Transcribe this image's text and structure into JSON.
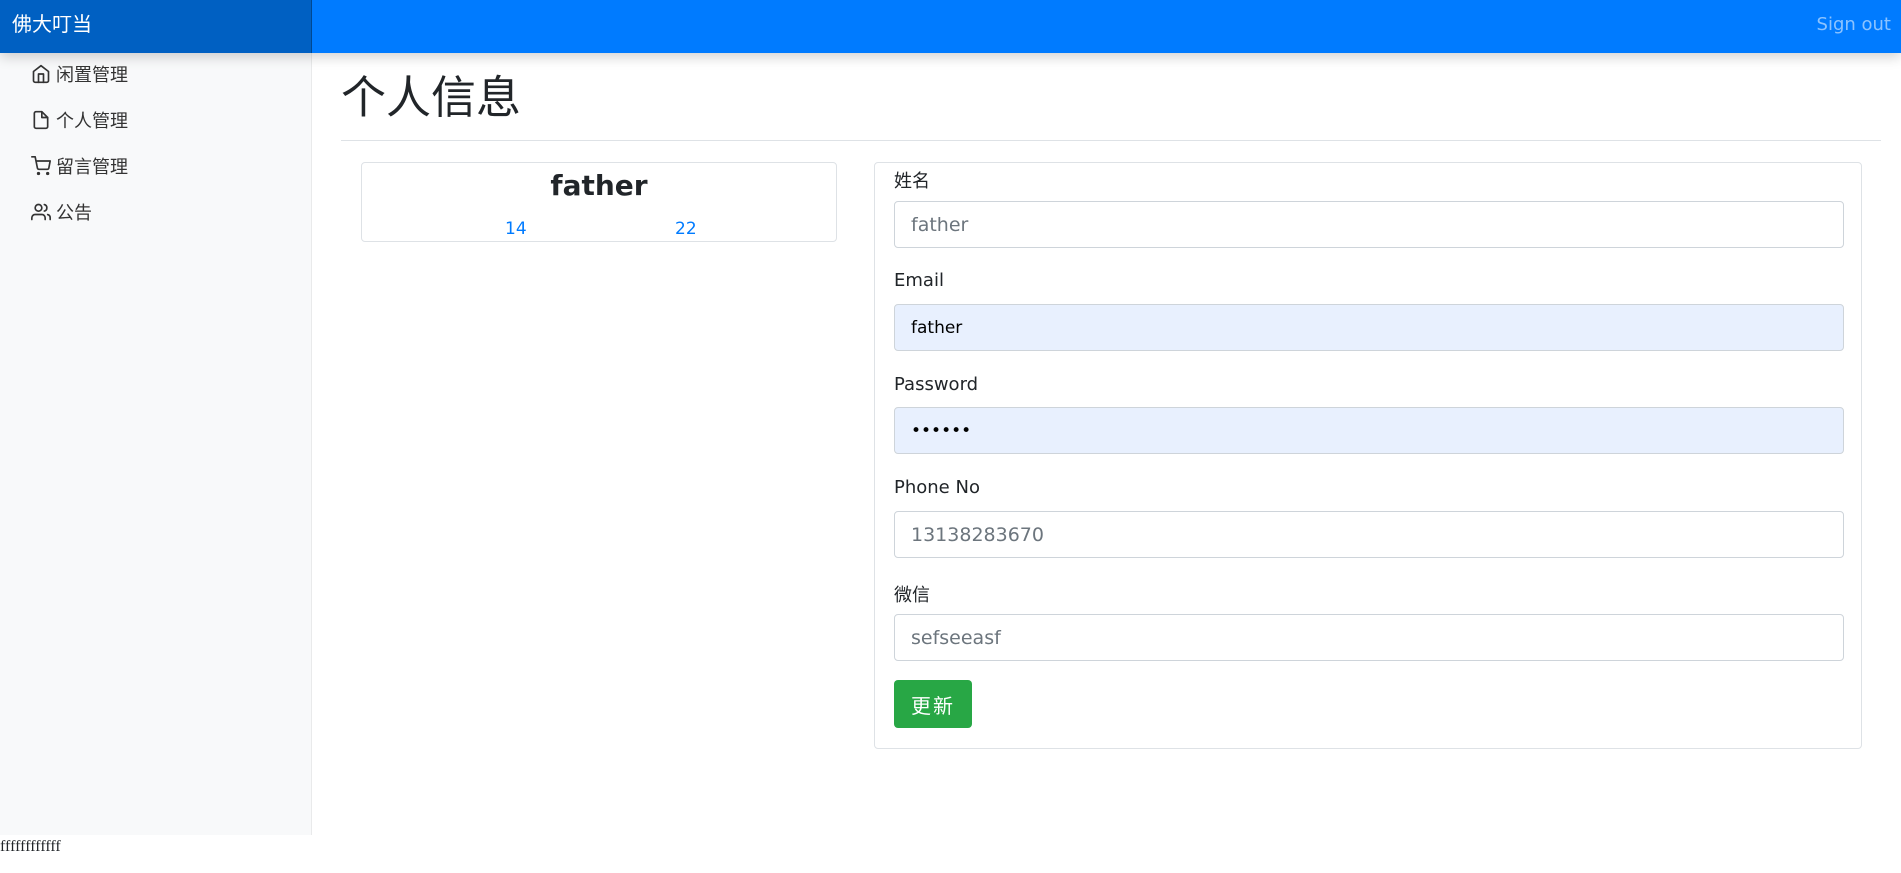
{
  "navbar": {
    "brand": "佛大叮当",
    "signout_label": "Sign out"
  },
  "sidebar": {
    "items": [
      {
        "label": "闲置管理",
        "icon": "home-icon"
      },
      {
        "label": "个人管理",
        "icon": "file-icon"
      },
      {
        "label": "留言管理",
        "icon": "shopping-cart-icon"
      },
      {
        "label": "公告",
        "icon": "users-icon"
      }
    ]
  },
  "main": {
    "title": "个人信息"
  },
  "profile": {
    "name": "father",
    "stat_left": "14",
    "stat_right": "22"
  },
  "form": {
    "name_label": "姓名",
    "name_placeholder": "father",
    "email_label": "Email",
    "email_value": "father",
    "password_label": "Password",
    "password_value": "••••••",
    "phone_label": "Phone No",
    "phone_placeholder": "13138283670",
    "wechat_label": "微信",
    "wechat_placeholder": "sefseeasf",
    "update_label": "更新"
  },
  "footer": {
    "text": "ffffffffffff"
  },
  "colors": {
    "navbar": "#007bff",
    "brand_bg": "#0060c2",
    "sidebar_bg": "#f8f9fa",
    "link": "#007bff",
    "update_button": "#28a745",
    "autofill_bg": "#e8f0fe"
  }
}
